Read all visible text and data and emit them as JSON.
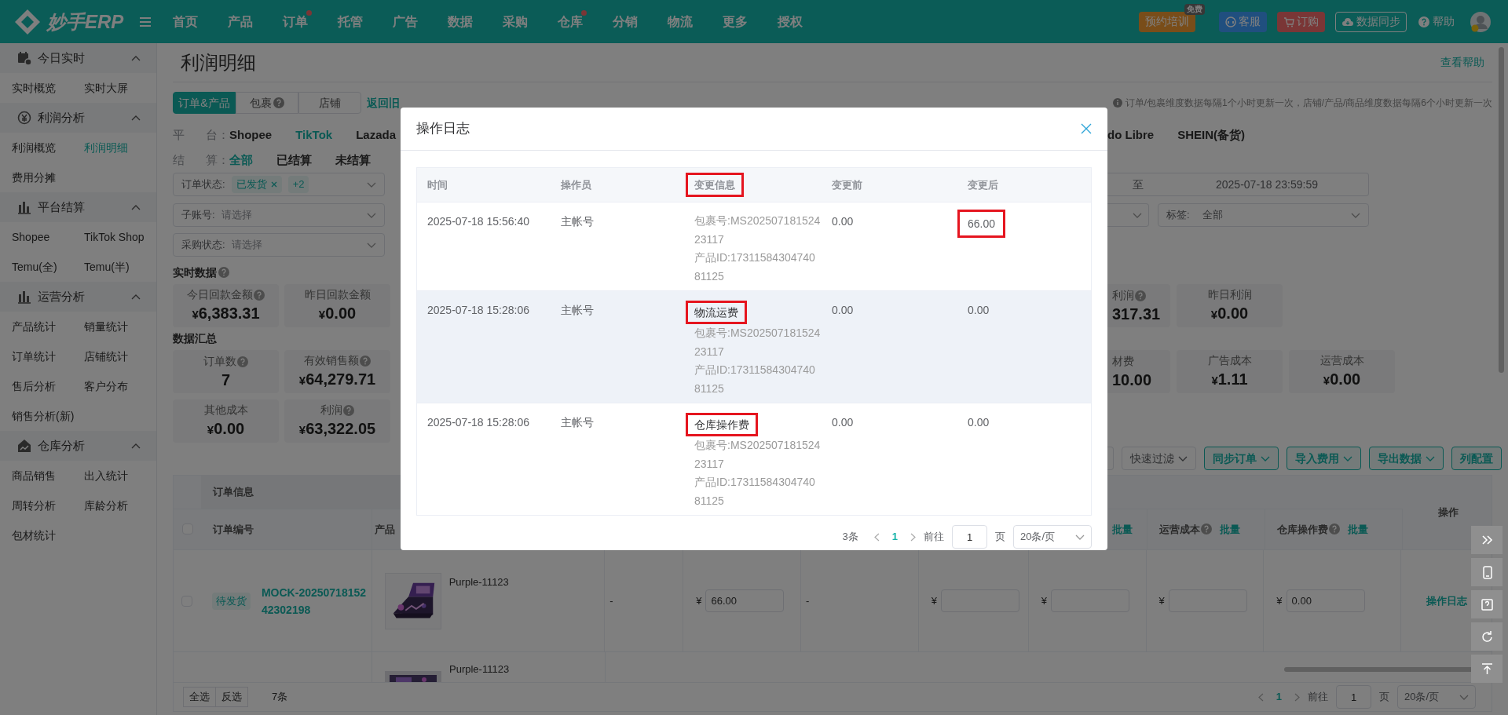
{
  "top_nav": {
    "logo": "妙手ERP",
    "items": [
      {
        "label": "首页",
        "dot": false
      },
      {
        "label": "产品",
        "dot": false
      },
      {
        "label": "订单",
        "dot": true
      },
      {
        "label": "托管",
        "dot": false
      },
      {
        "label": "广告",
        "dot": false
      },
      {
        "label": "数据",
        "dot": false
      },
      {
        "label": "采购",
        "dot": false
      },
      {
        "label": "仓库",
        "dot": true
      },
      {
        "label": "分销",
        "dot": false
      },
      {
        "label": "物流",
        "dot": false
      },
      {
        "label": "更多",
        "dot": false
      },
      {
        "label": "授权",
        "dot": false
      }
    ],
    "actions": [
      {
        "kind": "training",
        "label": "预约培训",
        "badge": "免费"
      },
      {
        "kind": "service",
        "label": "客服"
      },
      {
        "kind": "order",
        "label": "订购"
      },
      {
        "kind": "sync",
        "label": "数据同步"
      }
    ],
    "help": "帮助"
  },
  "sidebar": [
    {
      "title": "今日实时",
      "expanded": true,
      "items": [
        {
          "label": "实时概览",
          "selected": false
        },
        {
          "label": "实时大屏",
          "selected": false
        }
      ]
    },
    {
      "title": "利润分析",
      "expanded": true,
      "items": [
        {
          "label": "利润概览",
          "selected": false
        },
        {
          "label": "利润明细",
          "selected": true
        },
        {
          "label": "费用分摊",
          "selected": false
        }
      ]
    },
    {
      "title": "平台结算",
      "expanded": true,
      "items": [
        {
          "label": "Shopee",
          "selected": false
        },
        {
          "label": "TikTok Shop",
          "selected": false
        },
        {
          "label": "Temu(全)",
          "selected": false
        },
        {
          "label": "Temu(半)",
          "selected": false
        }
      ]
    },
    {
      "title": "运营分析",
      "expanded": true,
      "items": [
        {
          "label": "产品统计",
          "selected": false
        },
        {
          "label": "销量统计",
          "selected": false
        },
        {
          "label": "订单统计",
          "selected": false
        },
        {
          "label": "店铺统计",
          "selected": false
        },
        {
          "label": "售后分析",
          "selected": false
        },
        {
          "label": "客户分布",
          "selected": false
        },
        {
          "label": "销售分析(新)",
          "selected": false
        }
      ]
    },
    {
      "title": "仓库分析",
      "expanded": true,
      "items": [
        {
          "label": "商品销售",
          "selected": false
        },
        {
          "label": "出入统计",
          "selected": false
        },
        {
          "label": "周转分析",
          "selected": false
        },
        {
          "label": "库龄分析",
          "selected": false
        },
        {
          "label": "包材统计",
          "selected": false
        }
      ]
    }
  ],
  "page": {
    "title": "利润明细",
    "help_link": "查看帮助",
    "tabs": [
      {
        "label": "订单&产品",
        "selected": true,
        "help": false
      },
      {
        "label": "包裹",
        "selected": false,
        "help": true
      },
      {
        "label": "店铺",
        "selected": false,
        "help": false
      }
    ],
    "old_version_link": "返回旧",
    "tip": "订单/包裹维度数据每隔1个小时更新一次，店铺/产品/商品维度数据每隔6个小时更新一次"
  },
  "filters": {
    "platform": {
      "label": [
        "平",
        "台："
      ],
      "options": [
        {
          "label": "Shopee",
          "selected": false
        },
        {
          "label": "TikTok",
          "selected": true
        },
        {
          "label": "Lazada",
          "selected": false
        }
      ],
      "options_right": [
        {
          "label": "do Libre",
          "selected": false
        },
        {
          "label": "SHEIN(备货)",
          "selected": false
        }
      ]
    },
    "settlement": {
      "label": [
        "结",
        "算："
      ],
      "options": [
        {
          "label": "全部",
          "selected": true
        },
        {
          "label": "已结算",
          "selected": false
        },
        {
          "label": "未结算",
          "selected": false
        }
      ]
    },
    "selects": [
      {
        "label": "订单状态:",
        "tags": [
          {
            "text": "已发货",
            "closable": true
          },
          {
            "text": "+2",
            "closable": false
          }
        ]
      },
      {
        "label": "子账号:",
        "placeholder": "请选择"
      },
      {
        "label": "采购状态:",
        "placeholder": "请选择"
      }
    ],
    "date_range": {
      "separator": "至",
      "end": "2025-07-18 23:59:59"
    },
    "tag_select": {
      "label": "标签:",
      "value": "全部"
    }
  },
  "realtime": {
    "title": "实时数据",
    "help": true,
    "cards_left": [
      {
        "label": "今日回款金额",
        "help": true,
        "currency": "¥",
        "value": "6,383.31"
      },
      {
        "label": "昨日回款金额",
        "help": false,
        "currency": "¥",
        "value": "0.00"
      }
    ],
    "cards_right": [
      {
        "label": "利润",
        "help": true,
        "value": "317.31",
        "cut": true
      },
      {
        "label": "昨日利润",
        "help": false,
        "currency": "¥",
        "value": "0.00",
        "cut": false
      }
    ]
  },
  "summary": {
    "title": "数据汇总",
    "cards_left": [
      {
        "label": "订单数",
        "help": true,
        "value": "7"
      },
      {
        "label": "有效销售额",
        "help": true,
        "currency": "¥",
        "value": "64,279.71"
      }
    ],
    "cards_right": [
      {
        "label": "材费",
        "help": false,
        "value": "10.00",
        "cut": true
      },
      {
        "label": "广告成本",
        "help": false,
        "currency": "¥",
        "value": "1.11",
        "cut": false
      },
      {
        "label": "运营成本",
        "help": false,
        "currency": "¥",
        "value": "0.00",
        "cut": false
      }
    ],
    "cards_left_2": [
      {
        "label": "其他成本",
        "help": false,
        "currency": "¥",
        "value": "0.00"
      },
      {
        "label": "利润",
        "help": true,
        "currency": "¥",
        "value": "63,322.05"
      }
    ]
  },
  "toolbar": [
    {
      "label": "快速过滤",
      "kind": "plain",
      "caret": true
    },
    {
      "label": "同步订单",
      "kind": "primary",
      "caret": true
    },
    {
      "label": "导入费用",
      "kind": "primary",
      "caret": true
    },
    {
      "label": "导出数据",
      "kind": "primary",
      "caret": true
    },
    {
      "label": "列配置",
      "kind": "primary",
      "caret": false
    }
  ],
  "table": {
    "group_header": "订单信息",
    "select_all_checked": false,
    "columns_left": [
      "订单编号",
      "产品"
    ],
    "columns_right": [
      {
        "batch": "批量"
      },
      {
        "title": "运营成本",
        "help": true,
        "batch": "批量"
      },
      {
        "title": "仓库操作费",
        "help": true,
        "batch": "批量"
      }
    ],
    "action_header": "操作",
    "rows": [
      {
        "checked": false,
        "status": "待发货",
        "order_no": "MOCK-2025071815242302198",
        "product": "Purple-11123",
        "cells": [
          {
            "kind": "text",
            "text": "-"
          },
          {
            "kind": "money",
            "currency": "¥",
            "value": "66.00"
          },
          {
            "kind": "text",
            "text": "-"
          },
          {
            "kind": "money",
            "currency": "¥"
          },
          {
            "kind": "money",
            "currency": "¥"
          },
          {
            "kind": "money",
            "currency": "¥"
          },
          {
            "kind": "money",
            "currency": "¥",
            "value": "0.00"
          }
        ],
        "action": "操作日志"
      }
    ],
    "next_row": {
      "product": "Purple-11123"
    }
  },
  "table_footer": {
    "buttons": [
      "全选",
      "反选"
    ],
    "count": "7条",
    "pages": [
      {
        "label": "1",
        "selected": true
      }
    ],
    "goto_label": "前往",
    "goto_value": "1",
    "page_suffix": "页",
    "page_size": "20条/页"
  },
  "modal": {
    "title": "操作日志",
    "columns": [
      {
        "label": "时间",
        "highlighted": false
      },
      {
        "label": "操作员",
        "highlighted": false
      },
      {
        "label": "变更信息",
        "highlighted": true
      },
      {
        "label": "变更前",
        "highlighted": false
      },
      {
        "label": "变更后",
        "highlighted": false
      }
    ],
    "rows": [
      {
        "time": "2025-07-18 15:56:40",
        "operator": "主帐号",
        "details": [
          "包裹号:MS20250718152423117",
          "产品ID:1731158430474081125"
        ],
        "before": "0.00",
        "after": "66.00",
        "after_highlighted": true,
        "hovered": false
      },
      {
        "time": "2025-07-18 15:28:06",
        "operator": "主帐号",
        "change_type": {
          "text": "物流运费",
          "highlighted": true
        },
        "details": [
          "包裹号:MS20250718152423117",
          "产品ID:1731158430474081125"
        ],
        "before": "0.00",
        "after": "0.00",
        "after_highlighted": false,
        "hovered": true
      },
      {
        "time": "2025-07-18 15:28:06",
        "operator": "主帐号",
        "change_type": {
          "text": "仓库操作费",
          "highlighted": true
        },
        "details": [
          "包裹号:MS20250718152423117",
          "产品ID:1731158430474081125"
        ],
        "before": "0.00",
        "after": "0.00",
        "after_highlighted": false,
        "hovered": false
      }
    ],
    "pagination": {
      "total": "3条",
      "pages": [
        {
          "label": "1",
          "selected": true
        }
      ],
      "goto_label": "前往",
      "goto_value": "1",
      "page_suffix": "页",
      "page_size": "20条/页"
    }
  }
}
